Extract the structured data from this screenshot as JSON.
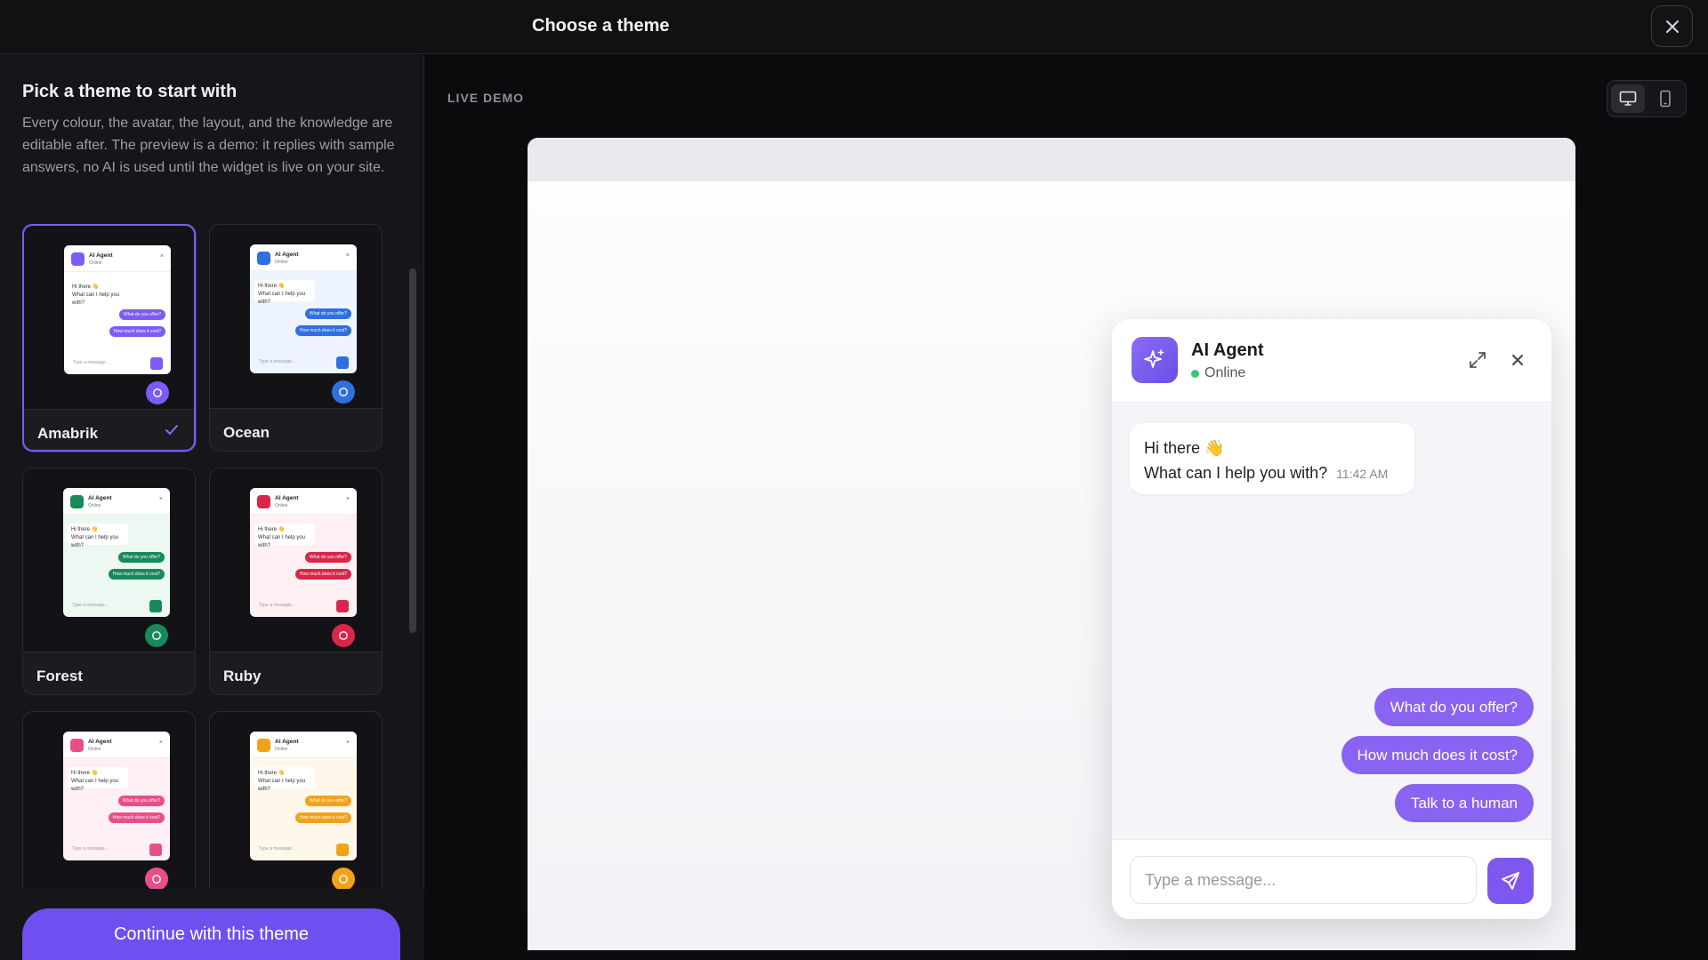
{
  "header": {
    "title": "Choose a theme"
  },
  "panel": {
    "heading": "Pick a theme to start with",
    "description": "Every colour, the avatar, the layout, and the knowledge are editable after. The preview is a demo: it replies with sample answers, no AI is used until the widget is live on your site.",
    "cta": "Continue with this theme",
    "themes": [
      {
        "name": "Amabrik",
        "accent": "#7c5cf4",
        "selected": true
      },
      {
        "name": "Ocean",
        "accent": "#2f6fe0",
        "selected": false
      },
      {
        "name": "Forest",
        "accent": "#168a5a",
        "selected": false
      },
      {
        "name": "Ruby",
        "accent": "#d9264a",
        "selected": false
      },
      {
        "name": "",
        "accent": "#e84f8a",
        "selected": false
      },
      {
        "name": "",
        "accent": "#f0a21a",
        "selected": false
      }
    ],
    "mini": {
      "agent": "AI Agent",
      "status": "Online",
      "greet1": "Hi there 👋",
      "greet2": "What can I help you with?",
      "q1": "What do you offer?",
      "q2": "How much does it cost?",
      "placeholder": "Type a message..."
    }
  },
  "demo": {
    "label": "LIVE DEMO",
    "device_active": "desktop",
    "chat": {
      "agent": "AI Agent",
      "status": "Online",
      "greeting_line1": "Hi there 👋",
      "greeting_line2": "What can I help you with?",
      "time": "11:42 AM",
      "suggestions": [
        "What do you offer?",
        "How much does it cost?",
        "Talk to a human"
      ],
      "placeholder": "Type a message..."
    }
  }
}
